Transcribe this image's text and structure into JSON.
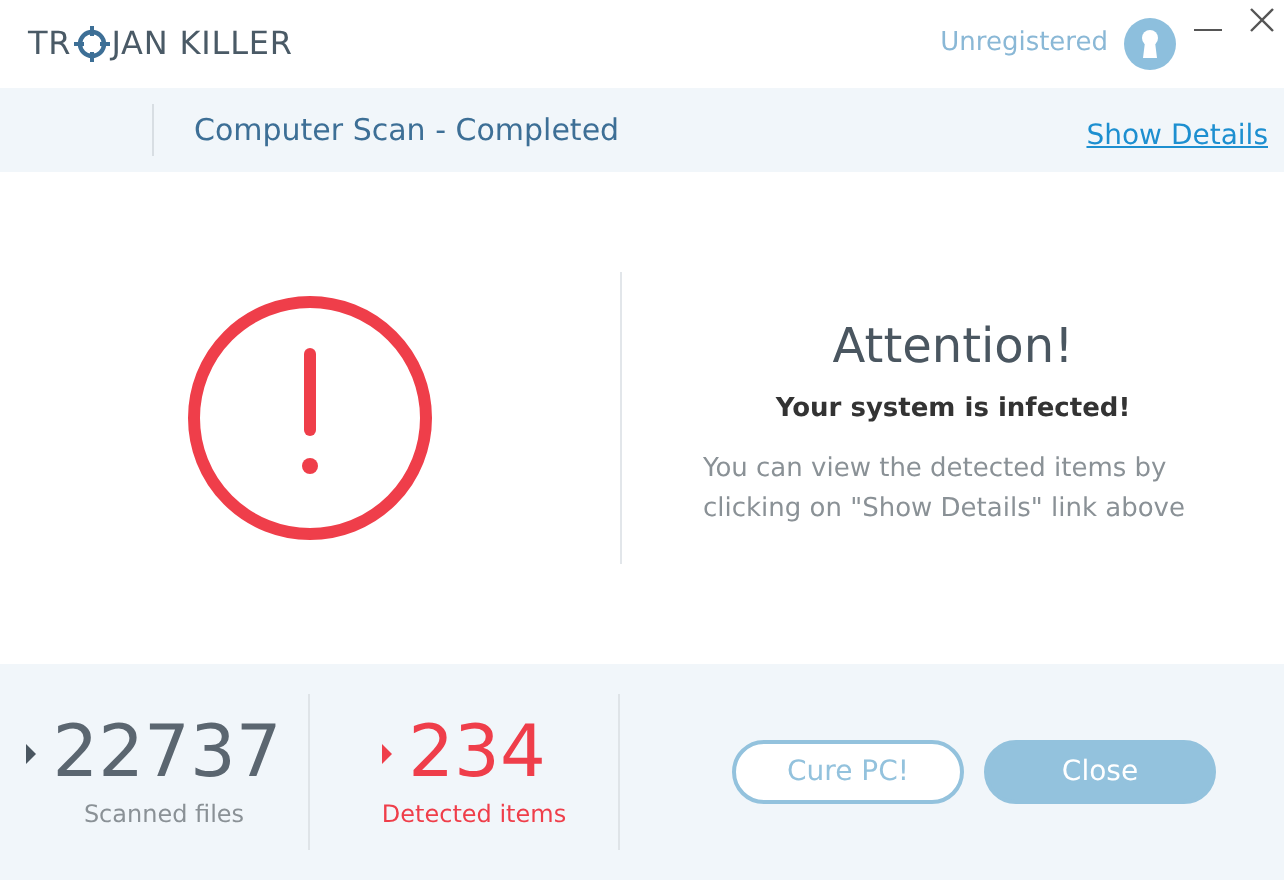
{
  "logo": {
    "text_before": "TR",
    "text_after": "JAN KILLER"
  },
  "account": {
    "label": "Unregistered"
  },
  "scan_bar": {
    "title": "Computer Scan - Completed",
    "link": "Show Details"
  },
  "alert": {
    "heading": "Attention!",
    "subheading": "Your system is infected!",
    "message": "You can view the detected items by clicking on \"Show Details\" link above"
  },
  "stats": [
    {
      "kind": "neutral",
      "value": "22737",
      "label": "Scanned files"
    },
    {
      "kind": "danger",
      "value": "234",
      "label": "Detected items"
    }
  ],
  "buttons": [
    {
      "kind": "outline",
      "label": "Cure PC!"
    },
    {
      "kind": "filled",
      "label": "Close"
    }
  ]
}
